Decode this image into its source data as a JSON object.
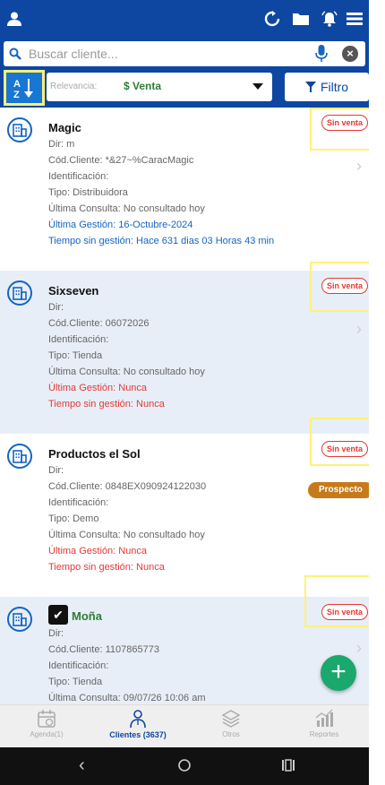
{
  "search": {
    "placeholder": "Buscar cliente...",
    "value": ""
  },
  "filters": {
    "relevance_label": "Relevancia:",
    "relevance_value": "$ Venta",
    "filter_label": "Filtro"
  },
  "clients": [
    {
      "name": "Magic",
      "dir": "Dir: m",
      "code": "Cód.Cliente: *&27~%CaracMagic",
      "identification": "Identificación:",
      "type": "Tipo: Distribuidora",
      "last_check": "Última Consulta: No consultado hoy",
      "last_action": "Última Gestión: 16-Octubre-2024",
      "time_without": "Tiempo sin gestión: Hace 631 dias 03 Horas 43 min",
      "status": "Sin venta"
    },
    {
      "name": "Sixseven",
      "dir": "Dir:",
      "code": "Cód.Cliente: 06072026",
      "identification": "Identificación:",
      "type": "Tipo: Tienda",
      "last_check": "Última Consulta: No consultado hoy",
      "last_action": "Última Gestión: Nunca",
      "time_without": "Tiempo sin gestión: Nunca",
      "status": "Sin venta"
    },
    {
      "name": "Productos el Sol",
      "dir": "Dir:",
      "code": "Cód.Cliente: 0848EX090924122030",
      "identification": "Identificación:",
      "type": "Tipo: Demo",
      "last_check": "Última Consulta: No consultado hoy",
      "last_action": "Última Gestión: Nunca",
      "time_without": "Tiempo sin gestión: Nunca",
      "status": "Sin venta",
      "tag": "Prospecto"
    },
    {
      "name": "Moña",
      "dir": "Dir:",
      "code": "Cód.Cliente: 1107865773",
      "identification": "Identificación:",
      "type": "Tipo: Tienda",
      "last_check": "Última Consulta: 09/07/26 10:06 am",
      "status": "Sin venta"
    }
  ],
  "bottom_nav": [
    {
      "label": "Agenda(1)",
      "icon": "calendar-icon"
    },
    {
      "label": "Clientes (3637)",
      "icon": "person-icon",
      "active": true
    },
    {
      "label": "Otros",
      "icon": "layers-icon"
    },
    {
      "label": "Reportes",
      "icon": "chart-icon"
    }
  ],
  "colors": {
    "primary": "#0d47a1",
    "highlight": "#fff176",
    "danger": "#e53935",
    "success": "#2e7d32",
    "prospect": "#c67a19",
    "fab": "#1aa86c"
  }
}
